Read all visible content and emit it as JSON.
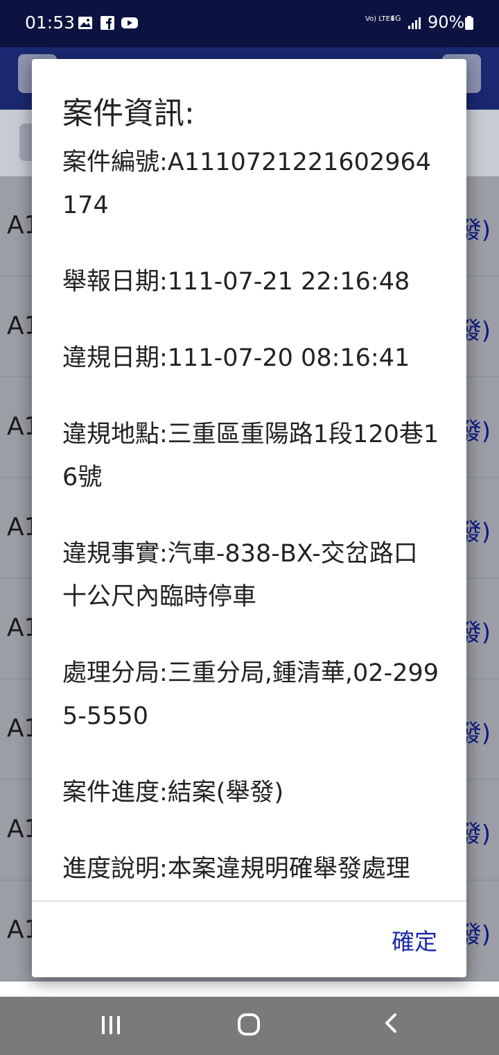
{
  "status_bar": {
    "time": "01:53",
    "network_label": "Vo) LTE1",
    "network_type": "4G",
    "battery": "90%",
    "icons": [
      "gallery-icon",
      "facebook-icon",
      "youtube-icon",
      "signal-icon",
      "battery-icon"
    ]
  },
  "background_list": {
    "rows": [
      {
        "id": "A1",
        "status": "發)"
      },
      {
        "id": "A1",
        "status": "發)"
      },
      {
        "id": "A1",
        "status": "發)"
      },
      {
        "id": "A1",
        "status": "發)"
      },
      {
        "id": "A1",
        "status": "發)"
      },
      {
        "id": "A1",
        "status": "發)"
      },
      {
        "id": "A1",
        "status": "發)"
      },
      {
        "id": "A1",
        "status": "發)"
      }
    ]
  },
  "dialog": {
    "title": "案件資訊:",
    "fields": [
      "案件編號:A1110721221602964174",
      "舉報日期:111-07-21 22:16:48",
      "違規日期:111-07-20 08:16:41",
      "違規地點:三重區重陽路1段120巷16號",
      "違規事實:汽車-838-BX-交岔路口十公尺內臨時停車",
      "處理分局:三重分局,鍾清華,02-2995-5550",
      "案件進度:結案(舉發)",
      "進度說明:本案違規明確舉發處理"
    ],
    "ok_label": "確定"
  },
  "colors": {
    "status_bar": "#0c1340",
    "app_bar": "#1a2870",
    "accent": "#1a2aa6"
  }
}
